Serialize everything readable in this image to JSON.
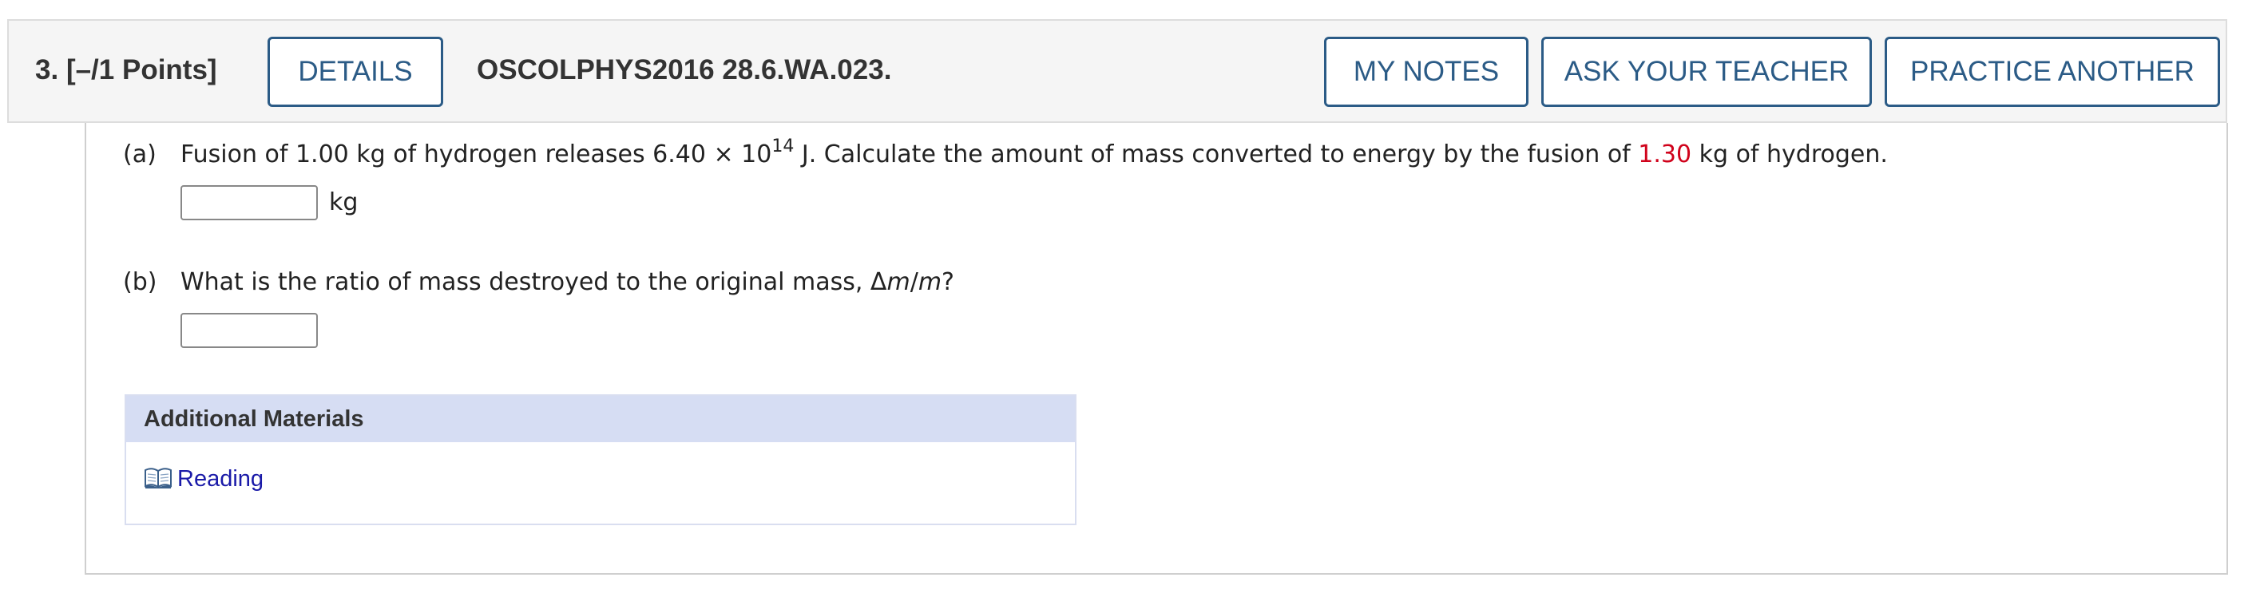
{
  "header": {
    "question_number": "3.",
    "points": "[–/1 Points]",
    "details_label": "DETAILS",
    "question_code": "OSCOLPHYS2016 28.6.WA.023.",
    "my_notes_label": "MY NOTES",
    "ask_teacher_label": "ASK YOUR TEACHER",
    "practice_another_label": "PRACTICE ANOTHER"
  },
  "part_a": {
    "label": "(a)",
    "text_before": "Fusion of 1.00 kg of hydrogen releases 6.40 × 10",
    "exponent": "14",
    "text_middle": " J. Calculate the amount of mass converted to energy by the fusion of ",
    "highlight_value": "1.30",
    "text_after": " kg of hydrogen.",
    "answer_value": "",
    "unit": "kg"
  },
  "part_b": {
    "label": "(b)",
    "text_before": "What is the ratio of mass destroyed to the original mass, Δ",
    "var_m1": "m",
    "slash": "/",
    "var_m2": "m",
    "text_after": "?",
    "answer_value": ""
  },
  "additional_materials": {
    "heading": "Additional Materials",
    "reading_label": "Reading",
    "reading_icon": "book-icon"
  },
  "colors": {
    "accent": "#2b5b86",
    "highlight_red": "#d0021b",
    "materials_header": "#d6ddf3",
    "link": "#1a1aa8"
  }
}
